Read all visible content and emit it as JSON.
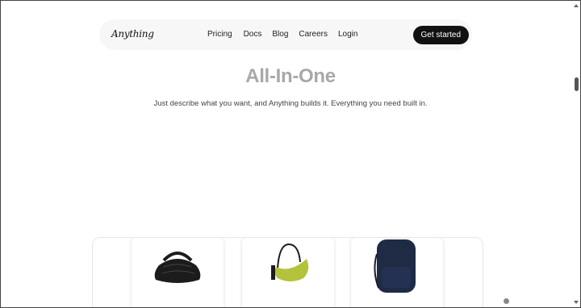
{
  "nav": {
    "logo": "Anything",
    "links": [
      "Pricing",
      "Docs",
      "Blog",
      "Careers",
      "Login"
    ],
    "cta_label": "Get started"
  },
  "hero": {
    "title": "All-In-One",
    "subtitle": "Just describe what you want, and Anything builds it. Everything you need built in."
  },
  "products": [
    {
      "name": "black-knotted-handbag",
      "color": "#1c1c1c"
    },
    {
      "name": "lime-crescent-shoulder-bag",
      "color": "#b5c23b"
    },
    {
      "name": "navy-backpack",
      "color": "#1f2a44"
    }
  ],
  "carousel": {
    "active_dot_color": "#888888"
  }
}
